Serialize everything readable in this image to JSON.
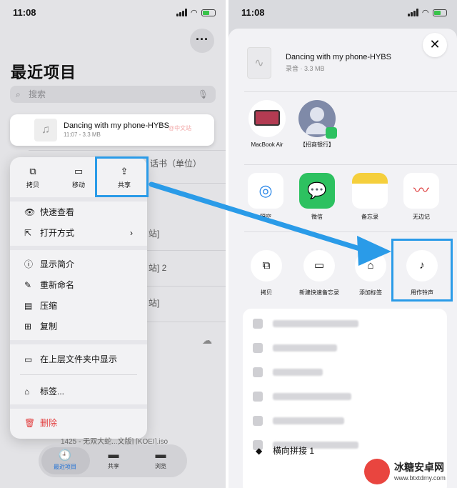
{
  "left": {
    "time": "11:08",
    "more": "···",
    "title": "最近项目",
    "search_placeholder": "搜索",
    "selected_file": {
      "name": "Dancing with my phone-HYBS",
      "meta": "11:07 - 3.3 MB",
      "watermark": "@中文站"
    },
    "bg_rows": [
      "话书（单位）",
      "站]",
      "站] 2",
      "站]"
    ],
    "quick_actions": [
      {
        "label": "拷贝",
        "icon": "copy-icon"
      },
      {
        "label": "移动",
        "icon": "folder-icon"
      },
      {
        "label": "共享",
        "icon": "share-icon"
      }
    ],
    "menu_items": [
      "快速查看",
      "打开方式",
      "显示简介",
      "重新命名",
      "压缩",
      "复制",
      "在上层文件夹中显示",
      "标签...",
      "删除"
    ],
    "bottom_file": "1425 - 无双大蛇...文版] [KOEI].iso",
    "tabs": [
      {
        "label": "最近项目"
      },
      {
        "label": "共享"
      },
      {
        "label": "浏览"
      }
    ]
  },
  "right": {
    "time": "11:08",
    "file": {
      "name": "Dancing with my phone-HYBS",
      "meta": "录音 · 3.3 MB"
    },
    "close": "✕",
    "people": [
      {
        "label": "MacBook Air"
      },
      {
        "label": "【招商银行】"
      }
    ],
    "apps": [
      {
        "label": "隔空"
      },
      {
        "label": "微信"
      },
      {
        "label": "备忘录"
      },
      {
        "label": "无边记"
      }
    ],
    "actions": [
      {
        "label": "拷贝"
      },
      {
        "label": "新建快速备忘录"
      },
      {
        "label": "添加标签"
      },
      {
        "label": "用作铃声"
      }
    ],
    "last_row": "横向拼接 1"
  },
  "watermark": {
    "name": "冰糖安卓网",
    "url": "www.btxtdmy.com"
  },
  "colors": {
    "highlight": "#2a9be8",
    "delete": "#e23b3b",
    "wechat": "#2dc160"
  }
}
